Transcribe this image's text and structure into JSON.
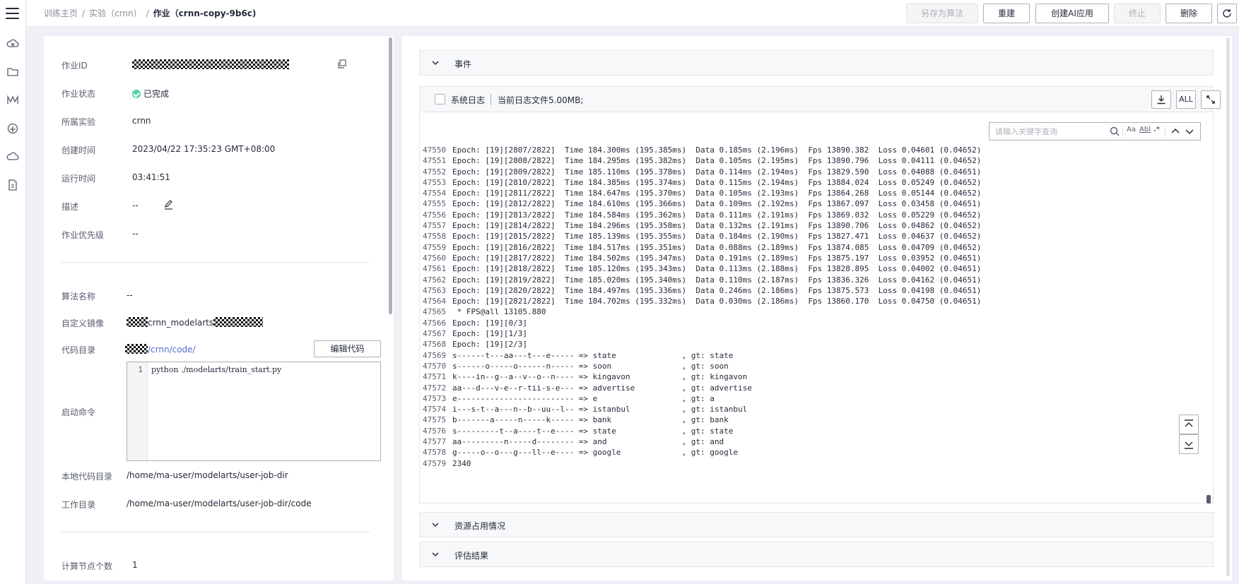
{
  "breadcrumb": {
    "home": "训练主页",
    "experiment": "实验（crnn）",
    "current": "作业（crnn-copy-9b6c)"
  },
  "toolbar": {
    "save_as_algorithm": "另存为算法",
    "rebuild": "重建",
    "create_ai_app": "创建AI应用",
    "stop": "终止",
    "delete": "删除"
  },
  "job_info": {
    "job_id_label": "作业ID",
    "status_label": "作业状态",
    "status_value": "已完成",
    "experiment_label": "所属实验",
    "experiment_value": "crnn",
    "created_label": "创建时间",
    "created_value": "2023/04/22 17:35:23 GMT+08:00",
    "runtime_label": "运行时间",
    "runtime_value": "03:41:51",
    "desc_label": "描述",
    "desc_value": "--",
    "priority_label": "作业优先级",
    "priority_value": "--",
    "algorithm_label": "算法名称",
    "algorithm_value": "--",
    "image_label": "自定义镜像",
    "image_value": "crnn_modelarts",
    "code_dir_label": "代码目录",
    "code_dir_value": "/crnn/code/",
    "edit_code": "编辑代码",
    "start_cmd_label": "启动命令",
    "start_cmd_line_no": "1",
    "start_cmd_value": "python ./modelarts/train_start.py",
    "local_code_dir_label": "本地代码目录",
    "local_code_dir_value": "/home/ma-user/modelarts/user-job-dir",
    "work_dir_label": "工作目录",
    "work_dir_value": "/home/ma-user/modelarts/user-job-dir/code",
    "node_count_label": "计算节点个数",
    "node_count_value": "1"
  },
  "sections": {
    "events": "事件",
    "resources": "资源占用情况",
    "evaluation": "评估结果"
  },
  "log": {
    "system_log_label": "系统日志",
    "file_size": "当前日志文件5.00MB;",
    "all_button": "ALL",
    "search_placeholder": "请输入关键字查询",
    "opt_case": "Aa",
    "opt_word": "Abl",
    "opt_regex": ".*",
    "lines": [
      {
        "n": "47550",
        "t": "Epoch: [19][2807/2822]  Time 184.300ms (195.385ms)  Data 0.185ms (2.196ms)  Fps 13890.382  Loss 0.04601 (0.04652)"
      },
      {
        "n": "47551",
        "t": "Epoch: [19][2808/2822]  Time 184.295ms (195.382ms)  Data 0.105ms (2.195ms)  Fps 13890.796  Loss 0.04111 (0.04652)"
      },
      {
        "n": "47552",
        "t": "Epoch: [19][2809/2822]  Time 185.110ms (195.378ms)  Data 0.114ms (2.194ms)  Fps 13829.590  Loss 0.04088 (0.04651)"
      },
      {
        "n": "47553",
        "t": "Epoch: [19][2810/2822]  Time 184.385ms (195.374ms)  Data 0.115ms (2.194ms)  Fps 13884.024  Loss 0.05249 (0.04652)"
      },
      {
        "n": "47554",
        "t": "Epoch: [19][2811/2822]  Time 184.647ms (195.370ms)  Data 0.105ms (2.193ms)  Fps 13864.268  Loss 0.05144 (0.04652)"
      },
      {
        "n": "47555",
        "t": "Epoch: [19][2812/2822]  Time 184.610ms (195.366ms)  Data 0.109ms (2.192ms)  Fps 13867.097  Loss 0.03458 (0.04651)"
      },
      {
        "n": "47556",
        "t": "Epoch: [19][2813/2822]  Time 184.584ms (195.362ms)  Data 0.111ms (2.191ms)  Fps 13869.032  Loss 0.05229 (0.04652)"
      },
      {
        "n": "47557",
        "t": "Epoch: [19][2814/2822]  Time 184.296ms (195.358ms)  Data 0.132ms (2.191ms)  Fps 13890.706  Loss 0.04862 (0.04652)"
      },
      {
        "n": "47558",
        "t": "Epoch: [19][2815/2822]  Time 185.139ms (195.355ms)  Data 0.184ms (2.190ms)  Fps 13827.471  Loss 0.04637 (0.04652)"
      },
      {
        "n": "47559",
        "t": "Epoch: [19][2816/2822]  Time 184.517ms (195.351ms)  Data 0.088ms (2.189ms)  Fps 13874.085  Loss 0.04709 (0.04652)"
      },
      {
        "n": "47560",
        "t": "Epoch: [19][2817/2822]  Time 184.502ms (195.347ms)  Data 0.191ms (2.189ms)  Fps 13875.197  Loss 0.03952 (0.04651)"
      },
      {
        "n": "47561",
        "t": "Epoch: [19][2818/2822]  Time 185.120ms (195.343ms)  Data 0.113ms (2.188ms)  Fps 13828.895  Loss 0.04002 (0.04651)"
      },
      {
        "n": "47562",
        "t": "Epoch: [19][2819/2822]  Time 185.020ms (195.340ms)  Data 0.110ms (2.187ms)  Fps 13836.326  Loss 0.04162 (0.04651)"
      },
      {
        "n": "47563",
        "t": "Epoch: [19][2820/2822]  Time 184.497ms (195.336ms)  Data 0.246ms (2.186ms)  Fps 13875.573  Loss 0.04198 (0.04651)"
      },
      {
        "n": "47564",
        "t": "Epoch: [19][2821/2822]  Time 184.702ms (195.332ms)  Data 0.030ms (2.186ms)  Fps 13860.170  Loss 0.04750 (0.04651)"
      },
      {
        "n": "47565",
        "t": " * FPS@all 13105.880"
      },
      {
        "n": "47566",
        "t": "Epoch: [19][0/3]"
      },
      {
        "n": "47567",
        "t": "Epoch: [19][1/3]"
      },
      {
        "n": "47568",
        "t": "Epoch: [19][2/3]"
      },
      {
        "n": "47569",
        "t": "s------t---aa---t---e----- => state              , gt: state"
      },
      {
        "n": "47570",
        "t": "s------o-----o------n----- => soon               , gt: soon"
      },
      {
        "n": "47571",
        "t": "k----in--g--a--v--o--n---- => kingavon           , gt: kingavon"
      },
      {
        "n": "47572",
        "t": "aa---d---v-e--r-tii-s-e--- => advertise          , gt: advertise"
      },
      {
        "n": "47573",
        "t": "e------------------------- => e                  , gt: a"
      },
      {
        "n": "47574",
        "t": "i---s-t--a---n--b--uu--l-- => istanbul           , gt: istanbul"
      },
      {
        "n": "47575",
        "t": "b-------a-----n-----k----- => bank               , gt: bank"
      },
      {
        "n": "47576",
        "t": "s---------t--a----t--e---- => state              , gt: state"
      },
      {
        "n": "47577",
        "t": "aa---------n-----d-------- => and                , gt: and"
      },
      {
        "n": "47578",
        "t": "g-----o--o---g---ll--e---- => google             , gt: google"
      },
      {
        "n": "47579",
        "t": "2340"
      }
    ]
  },
  "icons": {
    "menu": "hamburger-icon",
    "copy": "copy-icon",
    "edit": "pencil-icon",
    "refresh": "refresh-icon",
    "download": "download-icon",
    "fullscreen": "fullscreen-icon"
  },
  "colors": {
    "link": "#526ecc",
    "success": "#50d4ab"
  }
}
